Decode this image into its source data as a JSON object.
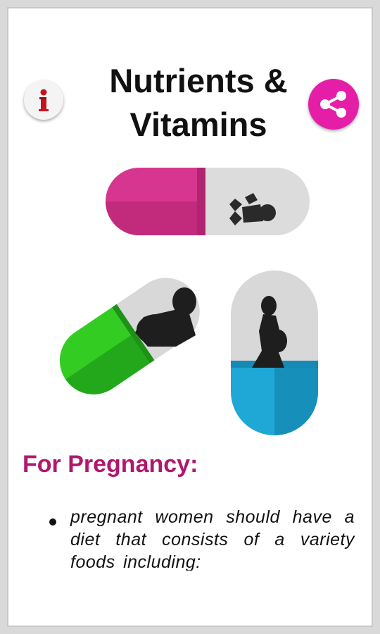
{
  "header": {
    "title_line1": "Nutrients &",
    "title_line2": "Vitamins"
  },
  "icons": {
    "info": "info-icon",
    "share": "share-icon"
  },
  "colors": {
    "heading": "#b0176e",
    "share_button": "#e51ea8",
    "pill_pink": "#d6368f",
    "pill_green": "#2dbb27",
    "pill_blue": "#1fa7d6"
  },
  "content": {
    "heading": "For Pregnancy:",
    "bullets": [
      "pregnant women should have a diet that consists of a variety foods including:"
    ]
  }
}
